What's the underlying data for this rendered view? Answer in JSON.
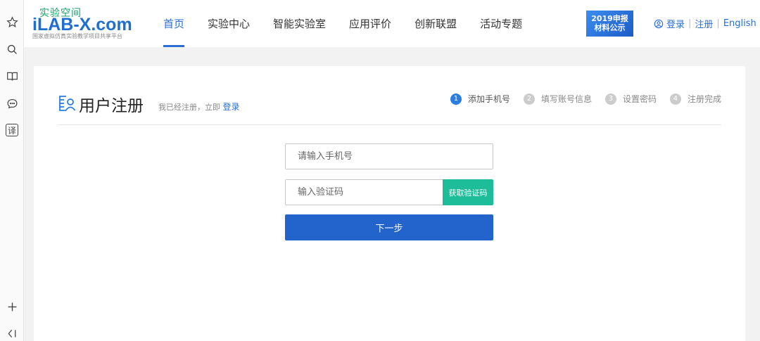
{
  "logo": {
    "cn": "实验空间",
    "en": "iLAB-X.com",
    "subtitle": "国家虚拟仿真实验教学项目共享平台"
  },
  "nav": [
    {
      "label": "首页",
      "active": true
    },
    {
      "label": "实验中心",
      "active": false
    },
    {
      "label": "智能实验室",
      "active": false
    },
    {
      "label": "应用评价",
      "active": false
    },
    {
      "label": "创新联盟",
      "active": false
    },
    {
      "label": "活动专题",
      "active": false
    }
  ],
  "badge": {
    "line1": "2019申报",
    "line2": "材料公示"
  },
  "auth": {
    "login": "登录",
    "register": "注册",
    "language": "English",
    "sep": "|"
  },
  "colors": {
    "primary": "#2264cc",
    "accent": "#1dbd9a",
    "nav_active": "#2a6ed4"
  },
  "page": {
    "title": "用户注册",
    "hint_prefix": "我已经注册，立即",
    "hint_link": "登录"
  },
  "steps": [
    {
      "num": "1",
      "label": "添加手机号",
      "active": true
    },
    {
      "num": "2",
      "label": "填写账号信息",
      "active": false
    },
    {
      "num": "3",
      "label": "设置密码",
      "active": false
    },
    {
      "num": "4",
      "label": "注册完成",
      "active": false
    }
  ],
  "form": {
    "phone_placeholder": "请输入手机号",
    "code_placeholder": "输入验证码",
    "get_code_label": "获取验证码",
    "next_label": "下一步"
  },
  "sidebar_icons": [
    "star-icon",
    "search-icon",
    "book-icon",
    "chat-icon",
    "translate-icon",
    "plus-icon",
    "collapse-icon"
  ],
  "sidebar_translate_glyph": "译"
}
